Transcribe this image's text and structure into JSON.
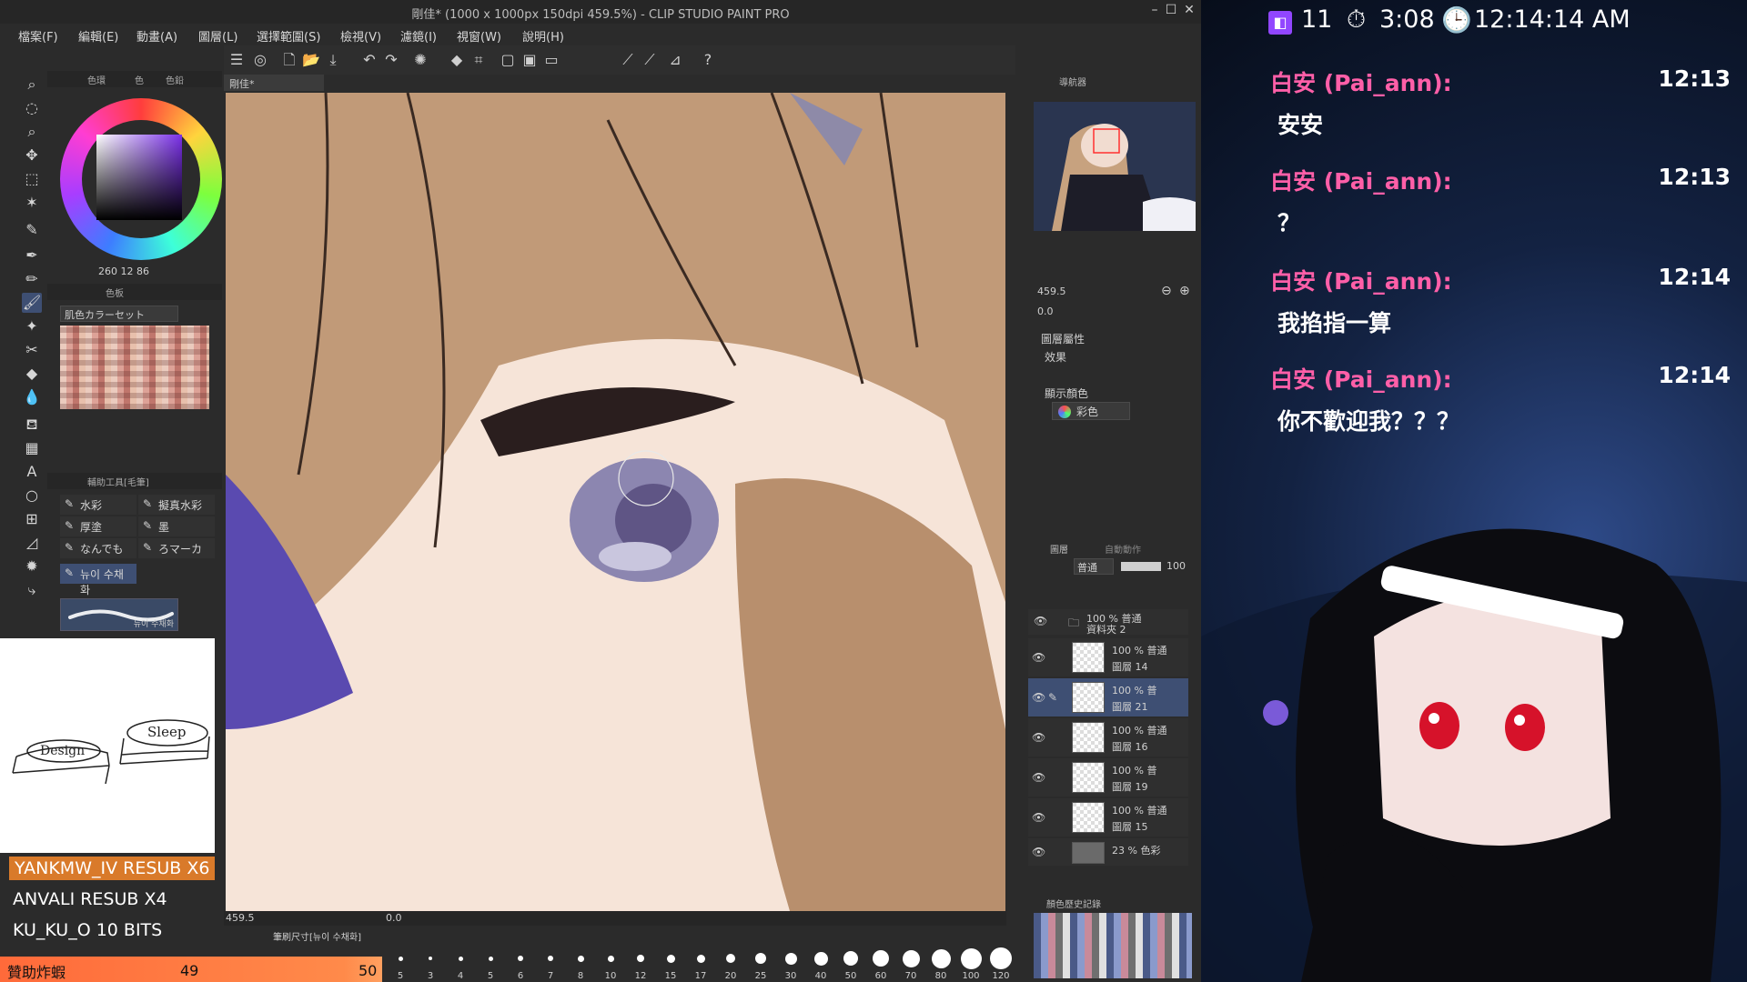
{
  "app": {
    "title": "剛佳* (1000 x 1000px 150dpi 459.5%) - CLIP STUDIO PAINT PRO",
    "menu": [
      "檔案(F)",
      "編輯(E)",
      "動畫(A)",
      "圖層(L)",
      "選擇範圍(S)",
      "檢視(V)",
      "濾鏡(I)",
      "視窗(W)",
      "說明(H)"
    ],
    "canvas_tab": "剛佳*",
    "colors": {
      "accent": "#3e4f73",
      "panel": "#2b2b2b",
      "skin": "#b88f6d"
    }
  },
  "color_panel": {
    "tabs": [
      "色環",
      "色",
      "色鉛"
    ],
    "readout": "260  12  86"
  },
  "palette_panel": {
    "title": "色板",
    "selected_set": "肌色カラーセット"
  },
  "subtool_panel": {
    "title": "輔助工具[毛筆]",
    "items": [
      "水彩",
      "擬真水彩",
      "厚塗",
      "墨",
      "なんでも",
      "ろマーカ",
      "뉴이 수채화"
    ],
    "preview_label": "뉴이 수채화"
  },
  "note": {
    "word1": "Design",
    "word2": "Sleep"
  },
  "stream_labels": [
    "YANKMW_IV  RESUB X6",
    "ANVALI  RESUB X4",
    "KU_KU_O  10 BITS"
  ],
  "donation": {
    "label": "贊助炸蝦",
    "current": "49",
    "goal": "50"
  },
  "canvas_status": {
    "zoom": "459.5",
    "angle": "0.0"
  },
  "brush_size_title": "筆刷尺寸[뉴이 수채화]",
  "brush_sizes": [
    "5",
    "3",
    "4",
    "5",
    "6",
    "7",
    "8",
    "10",
    "12",
    "15",
    "17",
    "20",
    "25",
    "30",
    "40",
    "50",
    "60",
    "70",
    "80",
    "100",
    "120"
  ],
  "navigator": {
    "title": "導航器",
    "zoom": "459.5",
    "angle": "0.0"
  },
  "layer_props": {
    "title": "圖層屬性",
    "effect_label": "效果",
    "display_color_label": "顯示顏色",
    "display_color": "彩色"
  },
  "layer_panel": {
    "tabs": [
      "圖層",
      "自動動作"
    ],
    "blend_mode": "普通",
    "opacity": "100",
    "folder": {
      "pct": "100 % 普通",
      "name": "資料夾 2"
    },
    "layers": [
      {
        "pct": "100 % 普通",
        "name": "圖層 14"
      },
      {
        "pct": "100 % 普",
        "name": "圖層 21"
      },
      {
        "pct": "100 % 普通",
        "name": "圖層 16"
      },
      {
        "pct": "100 % 普",
        "name": "圖層 19"
      },
      {
        "pct": "100 % 普通",
        "name": "圖層 15"
      },
      {
        "pct": "23 % 色彩",
        "name": ""
      }
    ]
  },
  "history_title": "顏色歷史記錄",
  "stream": {
    "stats": {
      "viewers": "11",
      "timer": "3:08",
      "clock": "12:14:14 AM"
    },
    "chat": [
      {
        "name": "白安 (Pai_ann):",
        "time": "12:13",
        "msg": "安安"
      },
      {
        "name": "白安 (Pai_ann):",
        "time": "12:13",
        "msg": "？"
      },
      {
        "name": "白安 (Pai_ann):",
        "time": "12:14",
        "msg": "我掐指一算"
      },
      {
        "name": "白安 (Pai_ann):",
        "time": "12:14",
        "msg": "你不歡迎我？？？"
      }
    ]
  }
}
